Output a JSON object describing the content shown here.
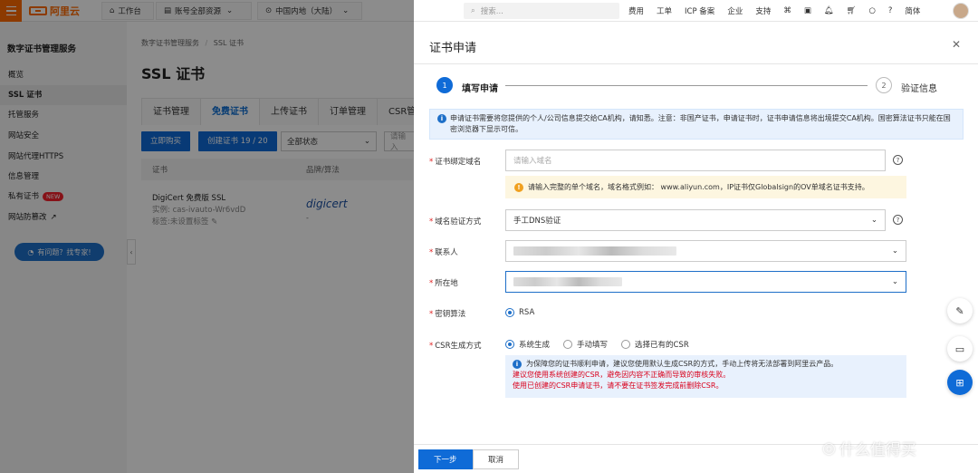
{
  "topbar": {
    "logo": "阿里云",
    "workbench": "工作台",
    "account_scope": "账号全部资源",
    "region": "中国内地（大陆）",
    "search_placeholder": "搜索...",
    "links": [
      "费用",
      "工单",
      "ICP 备案",
      "企业",
      "支持"
    ],
    "language": "简体"
  },
  "sidebar": {
    "title": "数字证书管理服务",
    "items": [
      {
        "label": "概览"
      },
      {
        "label": "SSL 证书"
      },
      {
        "label": "托管服务"
      },
      {
        "label": "网站安全"
      },
      {
        "label": "网站代理HTTPS"
      },
      {
        "label": "信息管理"
      },
      {
        "label": "私有证书",
        "badge": "NEW"
      },
      {
        "label": "网站防篡改"
      }
    ],
    "help_button": "有问题？找专家!"
  },
  "main": {
    "breadcrumb": [
      "数字证书管理服务",
      "/",
      "SSL 证书"
    ],
    "title": "SSL 证书",
    "tabs": [
      "证书管理",
      "免费证书",
      "上传证书",
      "订单管理",
      "CSR管"
    ],
    "buy_button": "立即购买",
    "create_button": "创建证书 19 / 20",
    "status_select": "全部状态",
    "search_placeholder": "请输入",
    "table_headers": [
      "证书",
      "品牌/算法"
    ],
    "row": {
      "name": "DigiCert 免费版 SSL",
      "instance": "实例: cas-ivauto-Wr6vdD",
      "tags": "标签:未设置标签",
      "brand": "digicert",
      "algo": "-"
    }
  },
  "drawer": {
    "title": "证书申请",
    "steps": [
      {
        "num": "1",
        "label": "填写申请"
      },
      {
        "num": "2",
        "label": "验证信息"
      }
    ],
    "info": "申请证书需要将您提供的个人/公司信息提交给CA机构，请知悉。注意：非国产证书，申请证书时，证书申请信息将出境提交CA机构。国密算法证书只能在国密浏览器下显示可信。",
    "fields": {
      "domain": {
        "label": "证书绑定域名",
        "placeholder": "请输入域名"
      },
      "domain_hint": "请输入完整的单个域名，域名格式例如：  www.aliyun.com，IP证书仅Globalsign的OV单域名证书支持。",
      "verify": {
        "label": "域名验证方式",
        "value": "手工DNS验证"
      },
      "contact": {
        "label": "联系人"
      },
      "location": {
        "label": "所在地"
      },
      "algorithm": {
        "label": "密钥算法",
        "option": "RSA"
      },
      "csr": {
        "label": "CSR生成方式",
        "options": [
          "系统生成",
          "手动填写",
          "选择已有的CSR"
        ]
      }
    },
    "csr_info": {
      "line1": "为保障您的证书顺利申请，建议您使用默认生成CSR的方式，手动上传将无法部署到阿里云产品。",
      "line2": "建议您使用系统创建的CSR，避免因内容不正确而导致的审核失败。",
      "line3": "使用已创建的CSR申请证书，请不要在证书签发完成前删除CSR。"
    },
    "next_button": "下一步",
    "cancel_button": "取消"
  },
  "watermark": "什么值得买",
  "colors": {
    "brand": "#ff6a00",
    "primary": "#0f6bd7",
    "danger": "#d9001b"
  }
}
